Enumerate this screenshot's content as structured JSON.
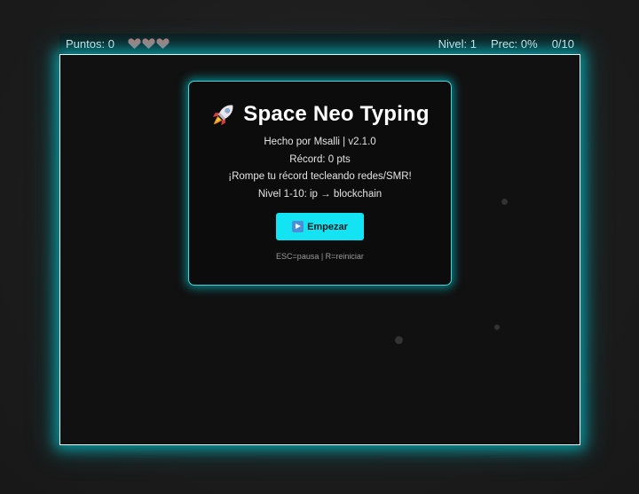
{
  "hud": {
    "score": "Puntos: 0",
    "lives": 3,
    "lives_icon": "heart-icon",
    "heart_color": "#b07878",
    "level": "Nivel: 1",
    "precision": "Prec: 0%",
    "progress": "0/10"
  },
  "menu": {
    "title": "Space Neo Typing",
    "title_icon": "rocket-icon",
    "credits": "Hecho por Msalli | v2.1.0",
    "record": "Récord: 0 pts",
    "tagline": "¡Rompe tu récord tecleando redes/SMR!",
    "level_range": "Nivel 1-10: ip → blockchain",
    "start_label": "Empezar",
    "controls_hint": "ESC=pausa | R=reiniciar"
  },
  "colors": {
    "accent": "#12e4f4",
    "glow": "#00dce6",
    "arena_bg": "#111111"
  }
}
